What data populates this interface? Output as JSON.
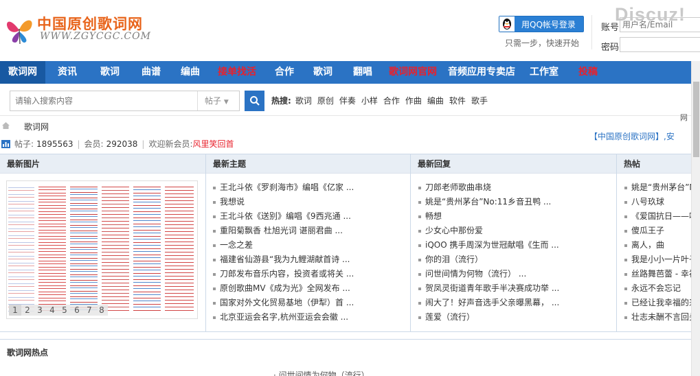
{
  "brand": {
    "logo_cn": "中国原创歌词网",
    "logo_url": "WWW.ZGYCGC.COM",
    "watermark": "Discuz!"
  },
  "login": {
    "qq_button": "用QQ帐号登录",
    "qq_tip": "只需一步，快速开始",
    "account_label": "账号",
    "account_placeholder": "用户名/Email",
    "password_label": "密码"
  },
  "nav": [
    {
      "label": "歌词网",
      "state": "active"
    },
    {
      "label": "资讯",
      "state": ""
    },
    {
      "label": "歌词",
      "state": ""
    },
    {
      "label": "曲谱",
      "state": ""
    },
    {
      "label": "编曲",
      "state": ""
    },
    {
      "label": "接单找活",
      "state": "red"
    },
    {
      "label": "合作",
      "state": ""
    },
    {
      "label": "歌词",
      "state": ""
    },
    {
      "label": "翻唱",
      "state": ""
    },
    {
      "label": "歌词网官网",
      "state": "red"
    },
    {
      "label": "音频应用专卖店",
      "state": ""
    },
    {
      "label": "工作室",
      "state": ""
    },
    {
      "label": "投稿",
      "state": "red"
    }
  ],
  "search": {
    "placeholder": "请输入搜索内容",
    "type": "帖子",
    "hot_label": "热搜:",
    "hot_terms": [
      "歌词",
      "原创",
      "伴奏",
      "小样",
      "合作",
      "作曲",
      "编曲",
      "软件",
      "歌手"
    ]
  },
  "breadcrumb": {
    "home": "歌词网"
  },
  "stats": {
    "posts_label": "帖子:",
    "posts": "1895563",
    "members_label": "会员:",
    "members": "292038",
    "welcome": "欢迎新会员:",
    "new_member": "风里笑回首"
  },
  "fragments": {
    "top_right": "网",
    "top_right2": "【中国原创歌词网】,安"
  },
  "columns": {
    "images_title": "最新图片",
    "topics_title": "最新主题",
    "replies_title": "最新回复",
    "hot_title": "热帖"
  },
  "pager": [
    "1",
    "2",
    "3",
    "4",
    "5",
    "6",
    "7",
    "8"
  ],
  "topics": [
    "王北斗依《罗刹海市》编唱《亿家 ...",
    "我想说",
    "王北斗依《送别》编唱《9西兆通 ...",
    "重阳菊飘香 杜旭光词 谌丽君曲 ...",
    "一念之差",
    "福建省仙游县“我为九鲤湖献首诗 ...",
    "刀郎发布音乐内容，投资者或将关 ...",
    "原创歌曲MV《成为光》全网发布 ...",
    "国家对外文化贸易基地（伊犁）首 ...",
    "北京亚运会名字,杭州亚运会会徽 ..."
  ],
  "replies": [
    "刀郎老师歌曲串烧",
    "姚是“贵州茅台”No:11乡音丑鸭 ...",
    "畅想",
    "少女心中那份爱",
    "iQOO 携手周深为世冠献唱《生而 ...",
    "你的泪（流行）",
    "问世间情为何物（流行）  ...",
    "贺凤灵街道青年歌手半决赛成功举 ...",
    "闹大了！好声音选手父亲曝黑幕，  ...",
    "莲爱（流行）"
  ],
  "hot_posts": [
    "姚是“贵州茅台”N",
    "八号玖球",
    "《爱国抗日——哑",
    "傻瓜王子",
    "离人，曲",
    "我是小小一片叶子",
    "丝路舞芭蕾 - 幸福",
    "永远不会忘记",
    "已经让我幸福的来",
    "壮志未酬不言回头"
  ],
  "hot_section": {
    "title": "歌词网热点",
    "fragment": "· 问世间情为何物（流行）"
  },
  "colors": {
    "nav_blue": "#2b73c4",
    "accent_red": "#e8212c",
    "logo_orange": "#e8641b"
  }
}
